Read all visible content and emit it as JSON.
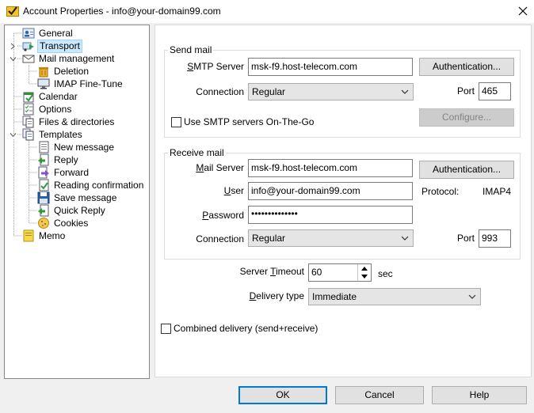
{
  "window": {
    "title": "Account Properties - info@your-domain99.com"
  },
  "tree": {
    "items": [
      {
        "label": "General",
        "icon": "person-card-icon"
      },
      {
        "label": "Transport",
        "icon": "transport-icon",
        "selected": true
      },
      {
        "label": "Mail management",
        "icon": "envelope-icon"
      },
      {
        "label": "Deletion",
        "icon": "trash-icon"
      },
      {
        "label": "IMAP Fine-Tune",
        "icon": "monitor-icon"
      },
      {
        "label": "Calendar",
        "icon": "calendar-icon"
      },
      {
        "label": "Options",
        "icon": "checklist-icon"
      },
      {
        "label": "Files & directories",
        "icon": "files-icon"
      },
      {
        "label": "Templates",
        "icon": "templates-icon"
      },
      {
        "label": "New message",
        "icon": "new-message-icon"
      },
      {
        "label": "Reply",
        "icon": "reply-icon"
      },
      {
        "label": "Forward",
        "icon": "forward-icon"
      },
      {
        "label": "Reading confirmation",
        "icon": "reading-confirmation-icon"
      },
      {
        "label": "Save message",
        "icon": "save-icon"
      },
      {
        "label": "Quick Reply",
        "icon": "quick-reply-icon"
      },
      {
        "label": "Cookies",
        "icon": "cookie-icon"
      },
      {
        "label": "Memo",
        "icon": "memo-icon"
      }
    ]
  },
  "send": {
    "legend": "Send mail",
    "server_label_pre": "",
    "server_label_ul": "S",
    "server_label_post": "MTP Server",
    "server_value": "msk-f9.host-telecom.com",
    "auth_button": "Authentication...",
    "connection_label": "Connection",
    "connection_value": "Regular",
    "port_label": "Port",
    "port_value": "465",
    "onthego_label": "Use SMTP servers On-The-Go",
    "onthego_checked": false,
    "configure_button": "Configure..."
  },
  "receive": {
    "legend": "Receive mail",
    "server_label_ul": "M",
    "server_label_post": "ail Server",
    "server_value": "msk-f9.host-telecom.com",
    "auth_button": "Authentication...",
    "user_label_ul": "U",
    "user_label_post": "ser",
    "user_value": "info@your-domain99.com",
    "protocol_label": "Protocol:",
    "protocol_value": "IMAP4",
    "password_label_ul": "P",
    "password_label_post": "assword",
    "password_value": "••••••••••••••",
    "connection_label": "Connection",
    "connection_value": "Regular",
    "port_label": "Port",
    "port_value": "993"
  },
  "timeout": {
    "label_pre": "Server ",
    "label_ul": "T",
    "label_post": "imeout",
    "value": "60",
    "unit": "sec"
  },
  "delivery": {
    "label_ul": "D",
    "label_post": "elivery type",
    "value": "Immediate"
  },
  "combined": {
    "label": "Combined delivery (send+receive)",
    "checked": false
  },
  "buttons": {
    "ok": "OK",
    "cancel": "Cancel",
    "help": "Help"
  },
  "colors": {
    "selection": "#cce8ff",
    "default_border": "#0078d7"
  }
}
